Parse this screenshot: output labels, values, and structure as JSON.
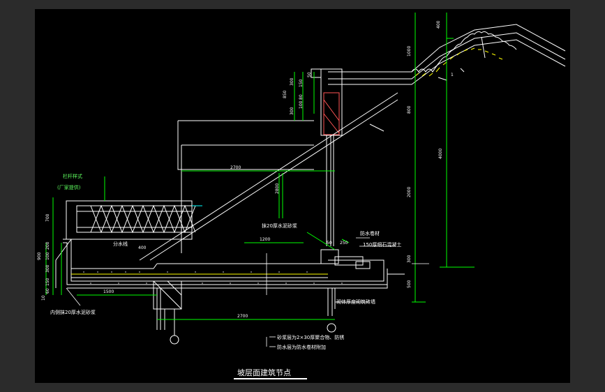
{
  "drawing": {
    "title": "坡层面建筑节点",
    "dimensions": {
      "d400_top": "400",
      "d1000": "1000",
      "d800_right": "800",
      "d4000": "4000",
      "d2000": "2000",
      "d300": "300",
      "d500": "500",
      "d2700_upper": "2700",
      "d2700_lower": "2700",
      "d1500": "1500",
      "d1200": "1200",
      "d2800": "2800",
      "d250": "250",
      "d400_mid": "400",
      "d700": "700",
      "d200": "200",
      "d100a": "100",
      "d300b": "300",
      "d150": "150",
      "d60": "60",
      "d10": "10",
      "d900": "900",
      "d300c": "300",
      "d850": "850",
      "d150b": "150",
      "d50": "50",
      "d80": "80",
      "d100b": "100",
      "d300d": "300",
      "d1": "1",
      "d50b": "50"
    },
    "notes": {
      "railing_style": "栏杆样式",
      "railing_factory": "(厂家提供)",
      "waterline": "分水线",
      "cement_mortar_top": "抹20厚水泥砂浆",
      "concrete_note": "防水卷材",
      "drain_note": "150厚细石混凝土",
      "cement_mortar_left": "内侧抹20厚水泥砂浆",
      "brick_wall": "砌体厚度砌筑砖墙",
      "leader_1": "砂浆层为2×30厚聚合物、防锈",
      "leader_2": "防水层为防水卷材附加"
    },
    "colors": {
      "background": "#000000",
      "frame": "#2b2b2b",
      "line": "#ffffff",
      "dimension": "#00ff00",
      "accent": "#ffff00"
    }
  }
}
